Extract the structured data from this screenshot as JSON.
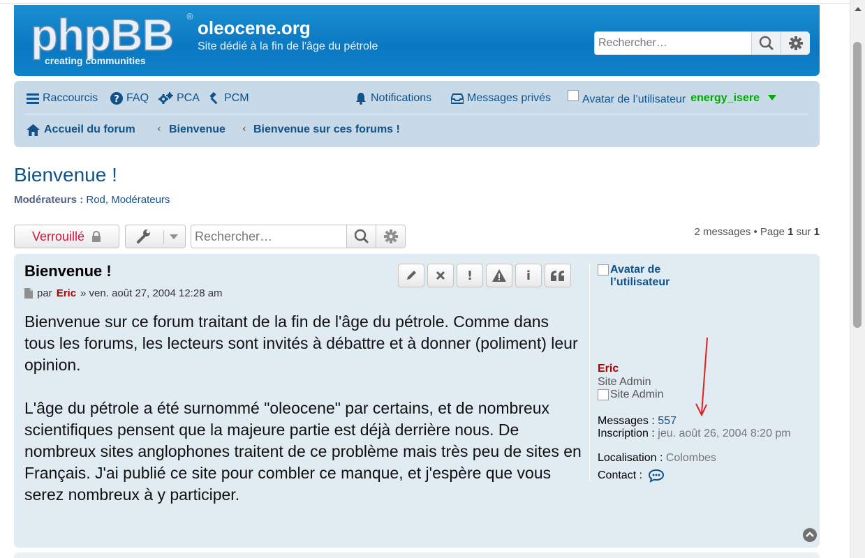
{
  "header": {
    "logo_text": "phpBB",
    "logo_tagline": "creating communities",
    "site_title": "oleocene.org",
    "site_description": "Site dédié à la fin de l'âge du pétrole",
    "search_placeholder": "Rechercher…"
  },
  "nav": {
    "items": [
      {
        "label": "Raccourcis",
        "icon": "bars-icon"
      },
      {
        "label": "FAQ",
        "icon": "question-circle-icon"
      },
      {
        "label": "PCA",
        "icon": "cogs-icon"
      },
      {
        "label": "PCM",
        "icon": "gavel-icon"
      }
    ],
    "notifications": "Notifications",
    "messages": "Messages privés",
    "avatar_alt": "Avatar de l’utilisateur",
    "username": "energy_isere"
  },
  "breadcrumbs": [
    "Accueil du forum",
    "Bienvenue",
    "Bienvenue sur ces forums !"
  ],
  "forum": {
    "title": "Bienvenue !",
    "moderators_label": "Modérateurs :",
    "moderators_value": "Rod, Modérateurs"
  },
  "actions": {
    "locked_label": "Verrouillé",
    "search_placeholder": "Rechercher…",
    "pagination": {
      "prefix": "2 messages • Page",
      "page": "1",
      "of": "sur",
      "total": "1"
    }
  },
  "post": {
    "title": "Bienvenue !",
    "by": "par",
    "author": "Eric",
    "date": "» ven. août 27, 2004 12:28 am",
    "paragraphs": [
      "Bienvenue sur ce forum traitant de la fin de l'âge du pétrole. Comme dans tous les forums, les lecteurs sont invités à débattre et à donner (poliment) leur opinion.",
      "L'âge du pétrole a été surnommé \"oleocene\" par certains, et de nombreux scientifiques pensent que la majeure partie est déjà derrière nous. De nombreux sites anglophones traitent de ce problème mais très peu de sites en Français. J'ai publié ce site pour combler ce manque, et j'espère que vous serez nombreux à y participer."
    ],
    "buttons": [
      "edit-icon",
      "delete-icon",
      "warn-icon",
      "report-icon",
      "info-icon",
      "quote-icon"
    ],
    "profile": {
      "avatar_alt": "Avatar de l’utilisateur",
      "name": "Eric",
      "rank": "Site Admin",
      "rank_img_alt": "Site Admin",
      "messages_label": "Messages :",
      "messages_value": "557",
      "joined_label": "Inscription :",
      "joined_value": "jeu. août 26, 2004 8:20 pm",
      "location_label": "Localisation :",
      "location_value": "Colombes",
      "contact_label": "Contact :"
    }
  },
  "colors": {
    "header_blue": "#0a78c2",
    "navbar_bg": "#c8d9e8",
    "post_bg": "#e1ebf2",
    "link": "#105289",
    "author_red": "#aa0000",
    "user_green": "#00aa00",
    "locked_red": "#d31141",
    "annotation_red": "#e02020"
  }
}
